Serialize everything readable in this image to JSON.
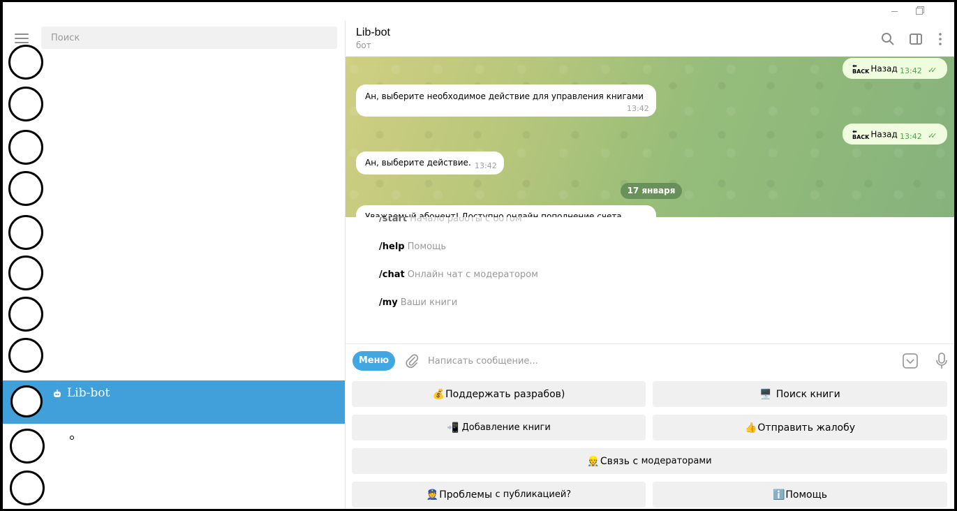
{
  "sidebar": {
    "search_placeholder": "Поиск",
    "selected_chat": {
      "name": "Lib-bot"
    }
  },
  "chat": {
    "title": "Lib-bot",
    "status": "бот"
  },
  "messages": [
    {
      "text": "Назад",
      "time": "13:42",
      "outgoing": true
    },
    {
      "text": "Ан, выберите необходимое действие для управления книгами",
      "time": "13:42",
      "outgoing": false
    },
    {
      "text": "Назад",
      "time": "13:42",
      "outgoing": true
    },
    {
      "text": "Ан, выберите действие.",
      "time": "13:42",
      "outgoing": false
    }
  ],
  "date_separator": "17 января",
  "partial_message": "Уважаемый абонент! Доступно онлайн пополнение счета",
  "commands": [
    {
      "cmd": "/start",
      "desc": "Начало работы с ботом"
    },
    {
      "cmd": "/help",
      "desc": "Помощь"
    },
    {
      "cmd": "/chat",
      "desc": "Онлайн чат с модератором"
    },
    {
      "cmd": "/my",
      "desc": "Ваши книги"
    }
  ],
  "compose": {
    "menu_label": "Меню",
    "placeholder": "Написать сообщение..."
  },
  "keyboard": {
    "support": {
      "emoji": "💰",
      "label": "Поддержать разрабов)"
    },
    "search": {
      "emoji": "🖥️",
      "label": "Поиск книги"
    },
    "add": {
      "emoji": "📲",
      "label": "Добавление книги"
    },
    "complaint": {
      "emoji": "👍",
      "label": "Отправить жалобу"
    },
    "moderators": {
      "emoji": "👷",
      "label_big": "Связь с",
      "label_small": "модераторами"
    },
    "problems": {
      "emoji": "👮",
      "label_big": "Проблемы",
      "label_small": "с публикацией?"
    },
    "help": {
      "emoji": "ℹ️",
      "label": "Помощь"
    }
  }
}
